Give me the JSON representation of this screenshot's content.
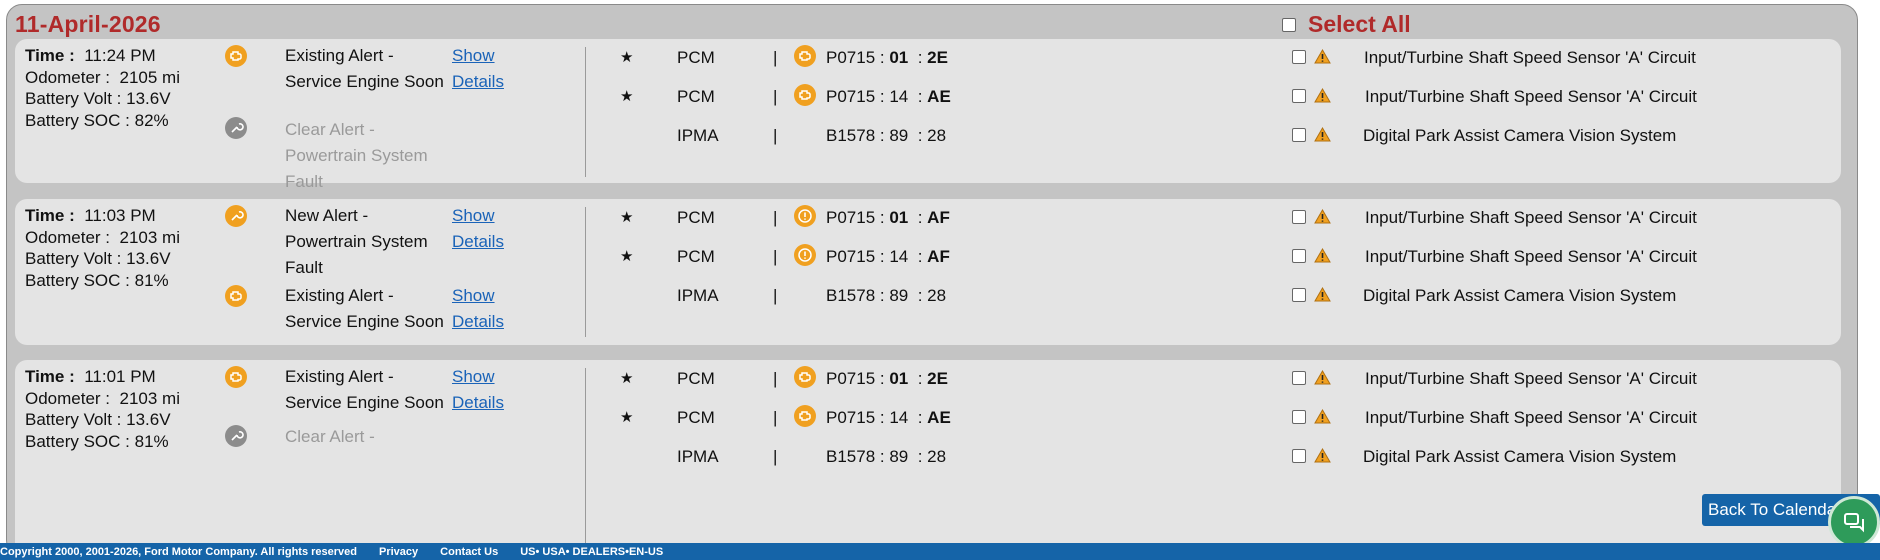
{
  "header": {
    "date": "11-April-2026",
    "select_all_label": "Select All"
  },
  "cards": [
    {
      "time_label": "Time :",
      "time": "11:24 PM",
      "odometer_label": "Odometer :",
      "odometer": "2105 mi",
      "battery_volt_label": "Battery Volt :",
      "battery_volt": "13.6V",
      "battery_soc_label": "Battery SOC :",
      "battery_soc": "82%",
      "alerts": [
        {
          "icon": "engine-icon",
          "line1": "Existing Alert -",
          "line2": "Service Engine Soon",
          "line3": "",
          "show": "Show",
          "details": "Details"
        },
        {
          "icon": "wrench-icon",
          "line1": "Clear Alert -",
          "line2": "Powertrain System",
          "line3": "Fault",
          "show": "",
          "details": ""
        }
      ],
      "dtcs": [
        {
          "star": "★",
          "module": "PCM",
          "sep": "|",
          "icon": "engine-icon",
          "code": "P0715",
          "c1": "01",
          "c2": "2E",
          "desc": "Input/Turbine Shaft Speed Sensor 'A' Circuit"
        },
        {
          "star": "★",
          "module": "PCM",
          "sep": "|",
          "icon": "engine-icon",
          "code": "P0715",
          "c1": "14",
          "c2": "AE",
          "desc": "Input/Turbine Shaft Speed Sensor 'A' Circuit"
        },
        {
          "star": "",
          "module": "IPMA",
          "sep": "|",
          "icon": "",
          "code": "B1578",
          "c1": "89",
          "c2": "28",
          "desc": "Digital Park Assist Camera Vision System"
        }
      ]
    },
    {
      "time_label": "Time :",
      "time": "11:03 PM",
      "odometer_label": "Odometer :",
      "odometer": "2103 mi",
      "battery_volt_label": "Battery Volt :",
      "battery_volt": "13.6V",
      "battery_soc_label": "Battery SOC :",
      "battery_soc": "81%",
      "alerts": [
        {
          "icon": "wrench-icon",
          "line1": "New Alert -",
          "line2": "Powertrain System",
          "line3": "Fault",
          "show": "Show",
          "details": "Details"
        },
        {
          "icon": "engine-icon",
          "line1": "Existing Alert -",
          "line2": "Service Engine Soon",
          "line3": "",
          "show": "Show",
          "details": "Details"
        }
      ],
      "dtcs": [
        {
          "star": "★",
          "module": "PCM",
          "sep": "|",
          "icon": "exclaim-icon",
          "code": "P0715",
          "c1": "01",
          "c2": "AF",
          "desc": "Input/Turbine Shaft Speed Sensor 'A' Circuit"
        },
        {
          "star": "★",
          "module": "PCM",
          "sep": "|",
          "icon": "exclaim-icon",
          "code": "P0715",
          "c1": "14",
          "c2": "AF",
          "desc": "Input/Turbine Shaft Speed Sensor 'A' Circuit"
        },
        {
          "star": "",
          "module": "IPMA",
          "sep": "|",
          "icon": "",
          "code": "B1578",
          "c1": "89",
          "c2": "28",
          "desc": "Digital Park Assist Camera Vision System"
        }
      ]
    },
    {
      "time_label": "Time :",
      "time": "11:01 PM",
      "odometer_label": "Odometer :",
      "odometer": "2103 mi",
      "battery_volt_label": "Battery Volt :",
      "battery_volt": "13.6V",
      "battery_soc_label": "Battery SOC :",
      "battery_soc": "81%",
      "alerts": [
        {
          "icon": "engine-icon",
          "line1": "Existing Alert -",
          "line2": "Service Engine Soon",
          "line3": "",
          "show": "Show",
          "details": "Details"
        },
        {
          "icon": "wrench-icon",
          "line1": "Clear Alert -",
          "line2": "",
          "line3": "",
          "show": "",
          "details": ""
        }
      ],
      "dtcs": [
        {
          "star": "★",
          "module": "PCM",
          "sep": "|",
          "icon": "engine-icon",
          "code": "P0715",
          "c1": "01",
          "c2": "2E",
          "desc": "Input/Turbine Shaft Speed Sensor 'A' Circuit"
        },
        {
          "star": "★",
          "module": "PCM",
          "sep": "|",
          "icon": "engine-icon",
          "code": "P0715",
          "c1": "14",
          "c2": "AE",
          "desc": "Input/Turbine Shaft Speed Sensor 'A' Circuit"
        },
        {
          "star": "",
          "module": "IPMA",
          "sep": "|",
          "icon": "",
          "code": "B1578",
          "c1": "89",
          "c2": "28",
          "desc": "Digital Park Assist Camera Vision System"
        }
      ]
    }
  ],
  "colors": {
    "title_red": "#b02a2a",
    "link_blue": "#1a63b8",
    "icon_orange": "#f0a020",
    "footer_blue": "#1564a8"
  },
  "footer": {
    "copyright": "Copyright 2000, 2001-2026, Ford Motor Company. All rights reserved",
    "privacy": "Privacy",
    "contact": "Contact Us",
    "locale": "US• USA• DEALERS•EN-US"
  },
  "back_to_calendar": "Back To Calendar",
  "chat_icon": "chat-icon"
}
